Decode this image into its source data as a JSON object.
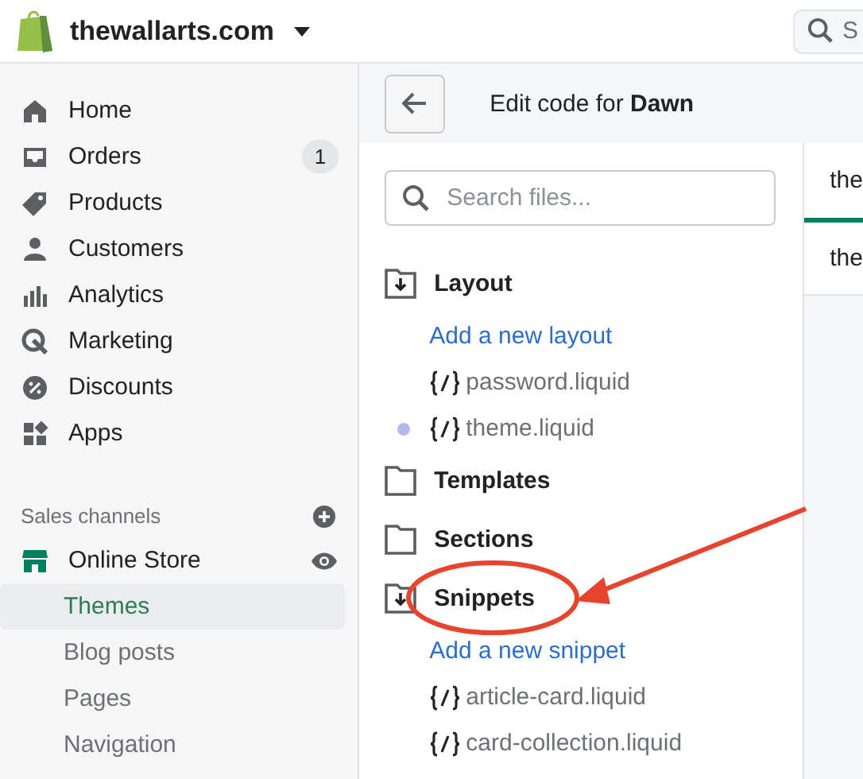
{
  "topbar": {
    "store_name": "thewallarts.com",
    "search_placeholder": "S"
  },
  "sidebar": {
    "items": [
      {
        "label": "Home"
      },
      {
        "label": "Orders",
        "badge": "1"
      },
      {
        "label": "Products"
      },
      {
        "label": "Customers"
      },
      {
        "label": "Analytics"
      },
      {
        "label": "Marketing"
      },
      {
        "label": "Discounts"
      },
      {
        "label": "Apps"
      }
    ],
    "sales_channels": {
      "heading": "Sales channels",
      "channel": "Online Store",
      "subitems": [
        {
          "label": "Themes",
          "selected": true
        },
        {
          "label": "Blog posts",
          "selected": false
        },
        {
          "label": "Pages",
          "selected": false
        },
        {
          "label": "Navigation",
          "selected": false
        }
      ]
    }
  },
  "editor": {
    "title": "Edit code for **Dawn**",
    "search_placeholder": "Search files...",
    "folders": [
      {
        "name": "Layout",
        "expanded": true,
        "add_link": "Add a new layout",
        "files": [
          {
            "name": "password.liquid",
            "modified": false
          },
          {
            "name": "theme.liquid",
            "modified": true
          }
        ]
      },
      {
        "name": "Templates",
        "expanded": false
      },
      {
        "name": "Sections",
        "expanded": false
      },
      {
        "name": "Snippets",
        "expanded": true,
        "add_link": "Add a new snippet",
        "files": [
          {
            "name": "article-card.liquid",
            "modified": false
          },
          {
            "name": "card-collection.liquid",
            "modified": false
          }
        ]
      }
    ],
    "tabs": [
      {
        "label": "the",
        "selected": true
      },
      {
        "label": "the",
        "selected": false
      }
    ]
  }
}
